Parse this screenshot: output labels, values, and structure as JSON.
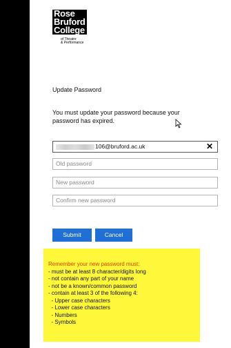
{
  "logo": {
    "lines": [
      "Rose",
      "Bruford",
      "College"
    ],
    "sub1": "of Theatre",
    "sub2": "& Performance"
  },
  "page_title": "Update Password",
  "message": "You must update your password because your password has expired.",
  "form": {
    "username_value": "106@bruford.ac.uk",
    "clear_label": "✕",
    "old_password_placeholder": "Old password",
    "new_password_placeholder": "New password",
    "confirm_password_placeholder": "Confirm new password"
  },
  "buttons": {
    "submit": "Submit",
    "cancel": "Cancel"
  },
  "note": {
    "heading": "Remember your new password must:",
    "rules": [
      "- must be at least 8 character/digits long",
      "- not contain any part of your name",
      "- not be a known/common password",
      "- contain at least 3 of the following 4:",
      "  - Upper case characters",
      "  - Lower case characters",
      "  - Numbers",
      "  - Symbols"
    ]
  },
  "colors": {
    "button": "#1f6fd6",
    "note_background": "#fff73a",
    "note_heading": "#e04000"
  }
}
